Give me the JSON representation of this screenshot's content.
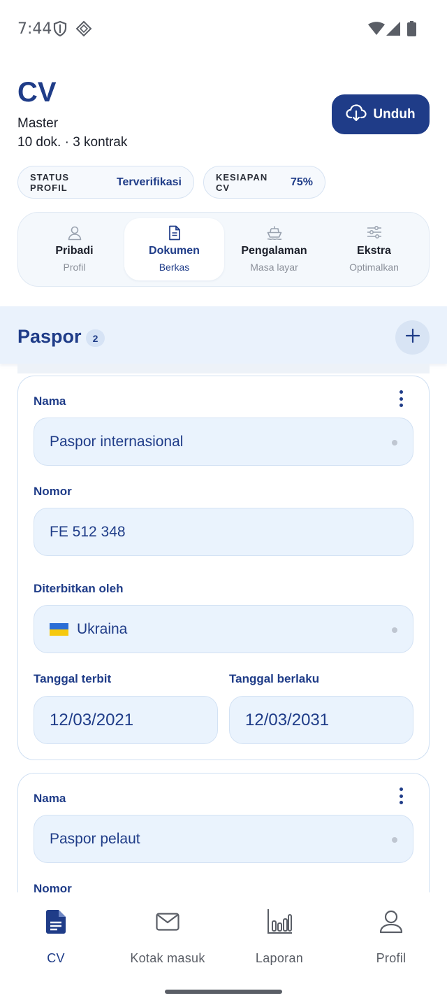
{
  "status_bar": {
    "time": "7:44"
  },
  "header": {
    "title": "CV",
    "subtitle": "Master",
    "meta": "10 dok. · 3 kontrak",
    "download_label": "Unduh"
  },
  "chips": [
    {
      "key": "STATUS PROFIL",
      "value": "Terverifikasi"
    },
    {
      "key": "KESIAPAN CV",
      "value": "75%"
    }
  ],
  "tabs": [
    {
      "label": "Pribadi",
      "sub": "Profil",
      "icon": "person-icon"
    },
    {
      "label": "Dokumen",
      "sub": "Berkas",
      "icon": "document-icon",
      "active": true
    },
    {
      "label": "Pengalaman",
      "sub": "Masa layar",
      "icon": "ship-icon"
    },
    {
      "label": "Ekstra",
      "sub": "Optimalkan",
      "icon": "sliders-icon"
    }
  ],
  "section": {
    "title": "Paspor",
    "count": "2"
  },
  "cards": [
    {
      "name_label": "Nama",
      "name_value": "Paspor internasional",
      "number_label": "Nomor",
      "number_value": "FE 512 348",
      "issued_label": "Diterbitkan oleh",
      "issued_value": "Ukraina",
      "issue_date_label": "Tanggal terbit",
      "issue_date_value": "12/03/2021",
      "valid_date_label": "Tanggal berlaku",
      "valid_date_value": "12/03/2031"
    },
    {
      "name_label": "Nama",
      "name_value": "Paspor pelaut",
      "number_label": "Nomor"
    }
  ],
  "bottom_nav": [
    {
      "label": "CV",
      "icon": "cv-document-icon",
      "active": true
    },
    {
      "label": "Kotak masuk",
      "icon": "mail-icon"
    },
    {
      "label": "Laporan",
      "icon": "bar-chart-icon"
    },
    {
      "label": "Profil",
      "icon": "person-icon"
    }
  ],
  "colors": {
    "primary": "#1f3c88",
    "field_bg": "#eaf3fd",
    "section_bg": "#eaf2fc"
  }
}
